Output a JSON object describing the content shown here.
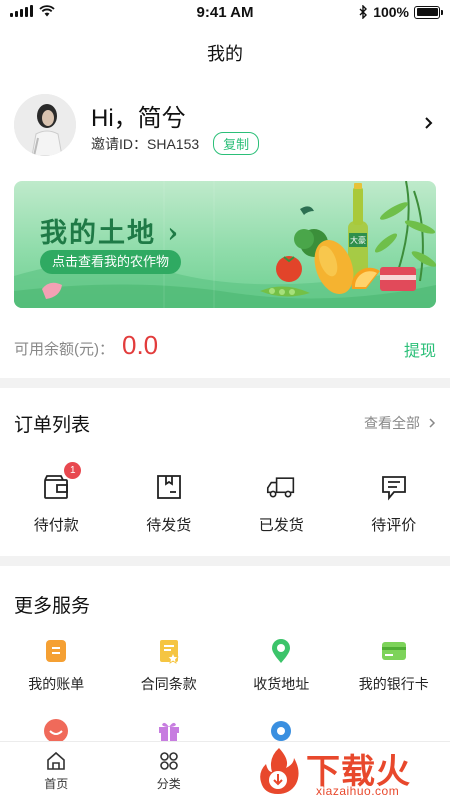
{
  "status_bar": {
    "time": "9:41 AM",
    "battery": "100%",
    "battery_level": 1.0
  },
  "nav": {
    "title": "我的"
  },
  "profile": {
    "greeting": "Hi，简兮",
    "invite_label": "邀请ID：",
    "invite_id": "SHA153",
    "copy_label": "复制"
  },
  "banner": {
    "title": "我的土地",
    "subtitle": "点击查看我的农作物",
    "bottle_label": "大豪"
  },
  "balance": {
    "label": "可用余额(元)：",
    "value": "0.0",
    "withdraw_label": "提现"
  },
  "orders": {
    "title": "订单列表",
    "view_all": "查看全部",
    "items": [
      {
        "label": "待付款",
        "icon": "wallet-icon",
        "badge": "1"
      },
      {
        "label": "待发货",
        "icon": "box-icon"
      },
      {
        "label": "已发货",
        "icon": "truck-icon"
      },
      {
        "label": "待评价",
        "icon": "comment-icon"
      }
    ]
  },
  "services": {
    "title": "更多服务",
    "items": [
      {
        "label": "我的账单",
        "icon": "bill-icon",
        "color": "#f5a033"
      },
      {
        "label": "合同条款",
        "icon": "contract-icon",
        "color": "#f5c542"
      },
      {
        "label": "收货地址",
        "icon": "location-icon",
        "color": "#3cc46a"
      },
      {
        "label": "我的银行卡",
        "icon": "bank-card-icon",
        "color": "#7dd35a"
      }
    ],
    "row2_icons": [
      {
        "icon": "smile-icon",
        "color": "#f06a5a"
      },
      {
        "icon": "gift-icon",
        "color": "#c77de0"
      },
      {
        "icon": "settings-icon",
        "color": "#3a8fe0"
      }
    ]
  },
  "tab_bar": {
    "items": [
      {
        "label": "首页",
        "icon": "home-icon"
      },
      {
        "label": "分类",
        "icon": "category-icon"
      }
    ]
  },
  "watermark": {
    "text": "下载火",
    "sub": "xiazaihuo.com"
  },
  "colors": {
    "accent": "#2bbf78",
    "balance": "#e23c3c",
    "badge": "#e8484f"
  }
}
